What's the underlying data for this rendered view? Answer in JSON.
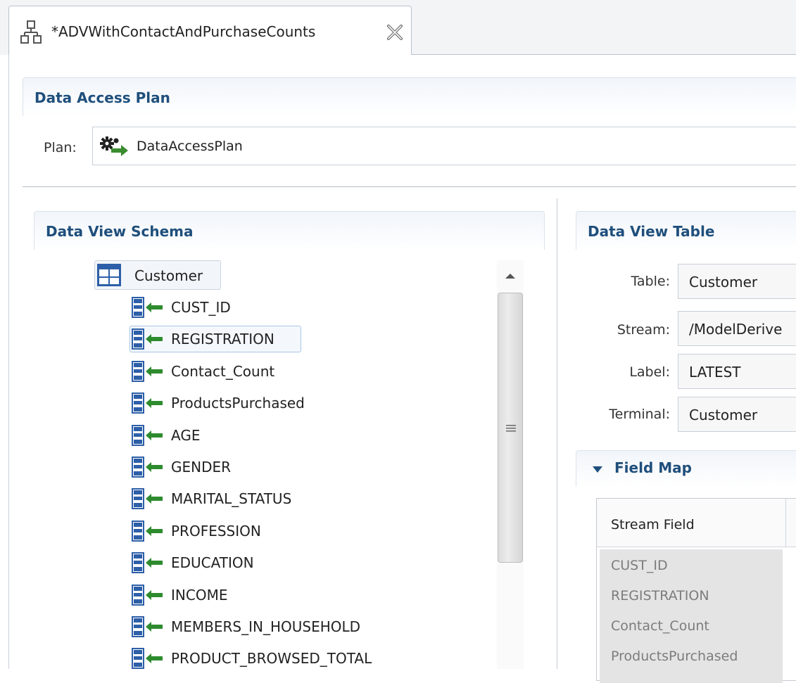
{
  "editor_tab": {
    "title": "*ADVWithContactAndPurchaseCounts"
  },
  "data_access_plan": {
    "title": "Data Access Plan",
    "plan_label": "Plan:",
    "plan_value": "DataAccessPlan"
  },
  "data_view_schema": {
    "title": "Data View Schema",
    "root": "Customer",
    "items": [
      "CUST_ID",
      "REGISTRATION",
      "Contact_Count",
      "ProductsPurchased",
      "AGE",
      "GENDER",
      "MARITAL_STATUS",
      "PROFESSION",
      "EDUCATION",
      "INCOME",
      "MEMBERS_IN_HOUSEHOLD",
      "PRODUCT_BROWSED_TOTAL"
    ],
    "selected_item": "REGISTRATION"
  },
  "data_view_table": {
    "title": "Data View Table",
    "table_label": "Table:",
    "table_value": "Customer",
    "stream_label": "Stream:",
    "stream_value": "/ModelDerive",
    "label_label": "Label:",
    "label_value": "LATEST",
    "terminal_label": "Terminal:",
    "terminal_value": "Customer"
  },
  "field_map": {
    "title": "Field Map",
    "column_header": "Stream Field",
    "rows": [
      "CUST_ID",
      "REGISTRATION",
      "Contact_Count",
      "ProductsPurchased"
    ]
  },
  "icons": {
    "tab": "hierarchy-icon",
    "close": "close-icon",
    "plan": "gear-arrow-icon",
    "table": "table-icon",
    "field": "field-arrow-icon",
    "scroll_up": "chevron-up-icon",
    "section_toggle": "chevron-down-icon"
  },
  "colors": {
    "section_title": "#1f4f7c",
    "arrow_green": "#2e8b2e",
    "table_blue": "#2d5fa8"
  }
}
